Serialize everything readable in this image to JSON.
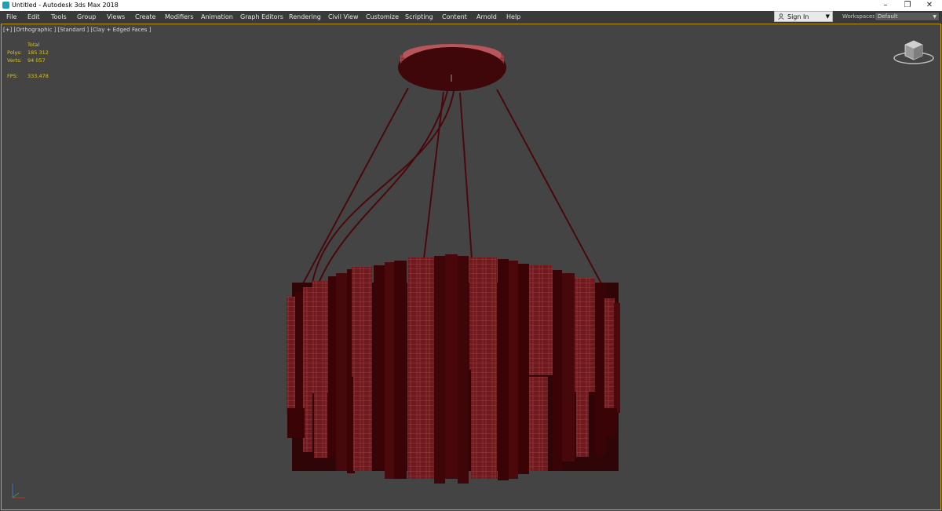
{
  "window": {
    "title": "Untitled - Autodesk 3ds Max 2018",
    "controls": [
      "–",
      "❐",
      "✕"
    ]
  },
  "menubar": {
    "items": [
      "File",
      "Edit",
      "Tools",
      "Group",
      "Views",
      "Create",
      "Modifiers",
      "Animation",
      "Graph Editors",
      "Rendering",
      "Civil View",
      "Customize",
      "Scripting",
      "Content",
      "Arnold",
      "Help"
    ]
  },
  "account": {
    "sign_in_label": "Sign In"
  },
  "workspaces": {
    "label": "Workspaces:",
    "value": "Default"
  },
  "viewport": {
    "label": "[+] [Orthographic ] [Standard ] [Clay + Edged Faces ]",
    "stats": {
      "total_label": "Total",
      "polys_label": "Polys:",
      "polys_value": "185 312",
      "verts_label": "Verts:",
      "verts_value": "94 057",
      "fps_label": "FPS:",
      "fps_value": "333,478"
    }
  },
  "colors": {
    "accent_border": "#c8a21a",
    "stats_text": "#d6c528",
    "model_light": "#b8555a",
    "model_dark": "#3a0608",
    "background": "#444444"
  },
  "icons": {
    "app": "3ds-max-icon",
    "user": "user-icon",
    "viewcube": "viewcube-icon",
    "axis": "axis-tripod-icon"
  }
}
